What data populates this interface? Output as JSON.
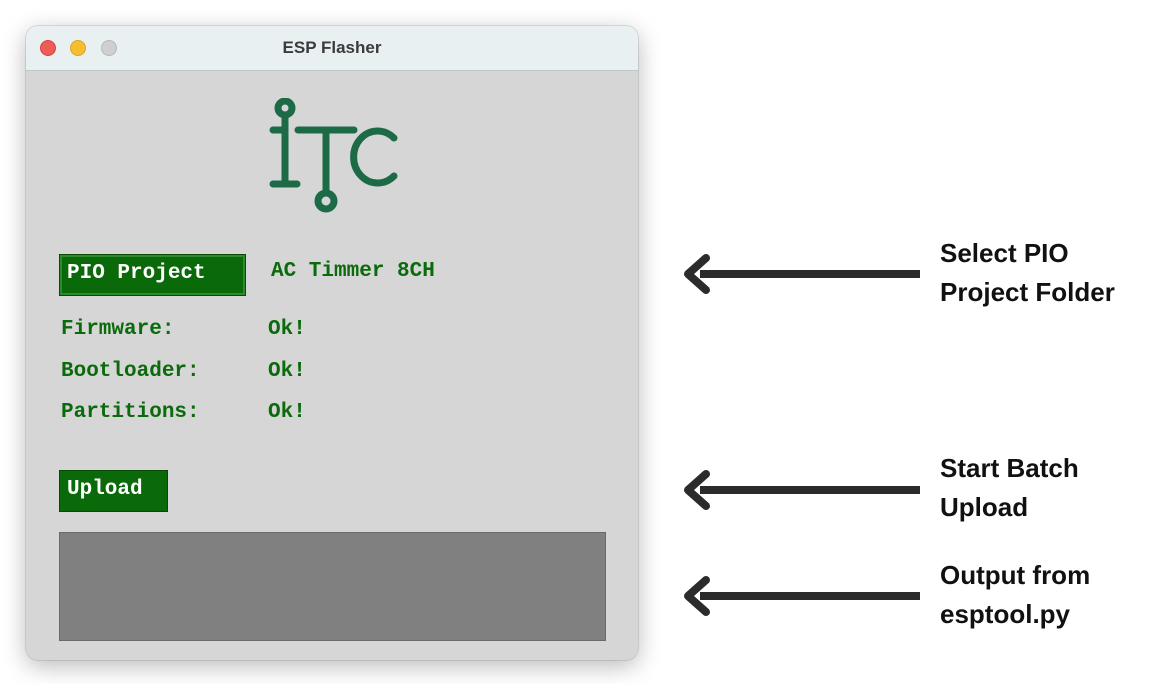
{
  "window": {
    "title": "ESP Flasher",
    "controls": [
      "close",
      "minimize",
      "zoom"
    ]
  },
  "logo": {
    "icon": "itc-circuit-logo",
    "color": "#1d6b46"
  },
  "project": {
    "button_label": "PIO Project",
    "name": "AC Timmer 8CH"
  },
  "status": [
    {
      "label": "Firmware:",
      "value": "Ok!"
    },
    {
      "label": "Bootloader:",
      "value": "Ok!"
    },
    {
      "label": "Partitions:",
      "value": "Ok!"
    }
  ],
  "upload": {
    "button_label": "Upload"
  },
  "output": {
    "text": ""
  },
  "annotations": [
    {
      "line1": "Select PIO",
      "line2": "Project Folder"
    },
    {
      "line1": "Start Batch",
      "line2": "Upload"
    },
    {
      "line1": "Output from",
      "line2": "esptool.py"
    }
  ],
  "colors": {
    "accent_green": "#0a6a0a",
    "logo_green": "#1d6b46",
    "window_bg": "#d6d6d6",
    "output_bg": "#808080"
  }
}
